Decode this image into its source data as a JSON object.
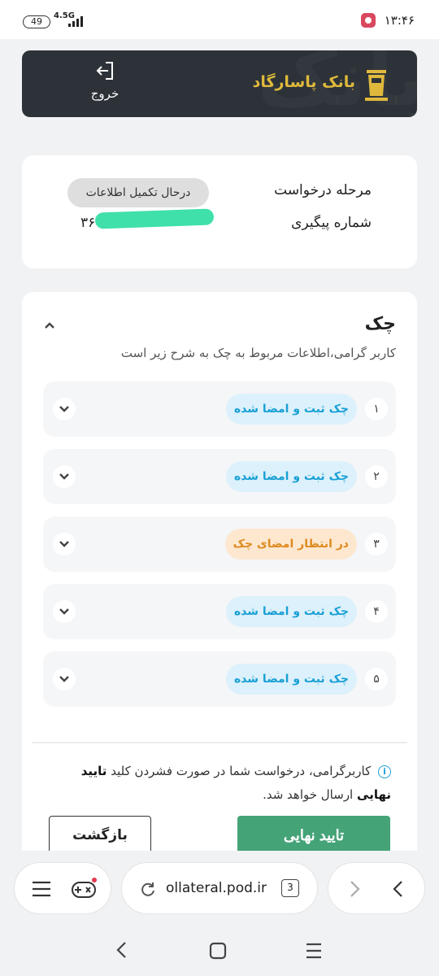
{
  "status_bar": {
    "battery": "49",
    "network": "4.5G",
    "time": "۱۳:۴۶"
  },
  "header": {
    "brand": "بانک پاسارگاد",
    "logout_label": "خروج"
  },
  "request_info": {
    "stage_label": "مرحله درخواست",
    "tracking_label": "شماره پیگیری",
    "status": "درحال تکمیل اطلاعات",
    "tracking_number": "۳۶            ۰۸"
  },
  "check_section": {
    "title": "چک",
    "subtitle": "کاربر گرامی،اطلاعات مربوط به چک به شرح زیر است",
    "items": [
      {
        "number": "۱",
        "status": "چک ثبت و امضا شده",
        "type": "ok"
      },
      {
        "number": "۲",
        "status": "چک ثبت و امضا شده",
        "type": "ok"
      },
      {
        "number": "۳",
        "status": "در انتظار امضای چک",
        "type": "wait"
      },
      {
        "number": "۴",
        "status": "چک ثبت و امضا شده",
        "type": "ok"
      },
      {
        "number": "۵",
        "status": "چک ثبت و امضا شده",
        "type": "ok"
      }
    ],
    "notice_prefix": "کاربرگرامی، درخواست شما در صورت فشردن کلید",
    "notice_bold": "تایید نهایی",
    "notice_suffix": "ارسال خواهد شد."
  },
  "actions": {
    "confirm": "تایید نهایی",
    "back": "بازگشت"
  },
  "browser": {
    "url": "ollateral.pod.ir",
    "tab_count": "3"
  },
  "colors": {
    "banner_bg": "#2c3237",
    "brand_gold": "#e0b93c",
    "confirm_green": "#45a378",
    "ok_pill_bg": "#dcf1fb",
    "ok_pill_text": "#1aa0d5",
    "wait_pill_bg": "#fde7cf",
    "wait_pill_text": "#dd8a1f"
  }
}
